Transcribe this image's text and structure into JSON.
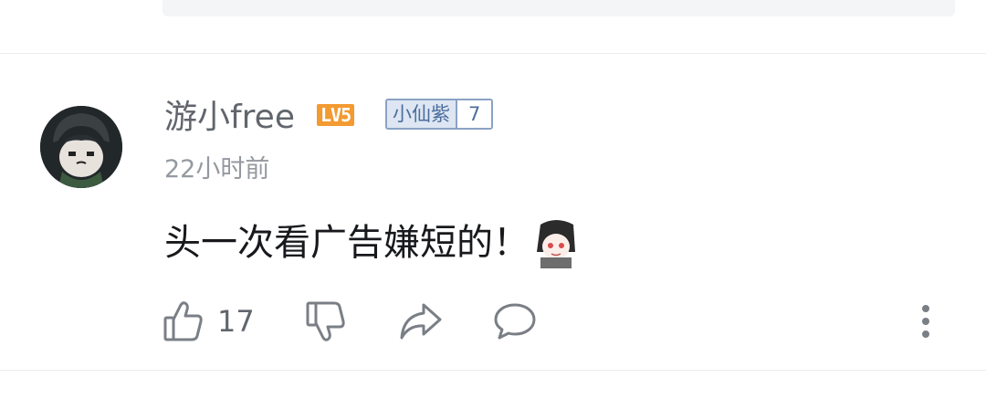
{
  "comment": {
    "username": "游小free",
    "level_badge": "LV5",
    "medal": {
      "name": "小仙紫",
      "level": "7"
    },
    "timestamp": "22小时前",
    "text": "头一次看广告嫌短的！",
    "like_count": "17"
  },
  "icons": {
    "like": "thumbs-up-icon",
    "dislike": "thumbs-down-icon",
    "share": "share-arrow-icon",
    "reply": "speech-bubble-icon",
    "more": "vertical-dots-icon"
  },
  "colors": {
    "level_badge": "#f39a31",
    "medal_border": "#8aa2c4",
    "medal_fill": "#dde6f2",
    "username": "#61666d",
    "timestamp": "#9499a0"
  }
}
